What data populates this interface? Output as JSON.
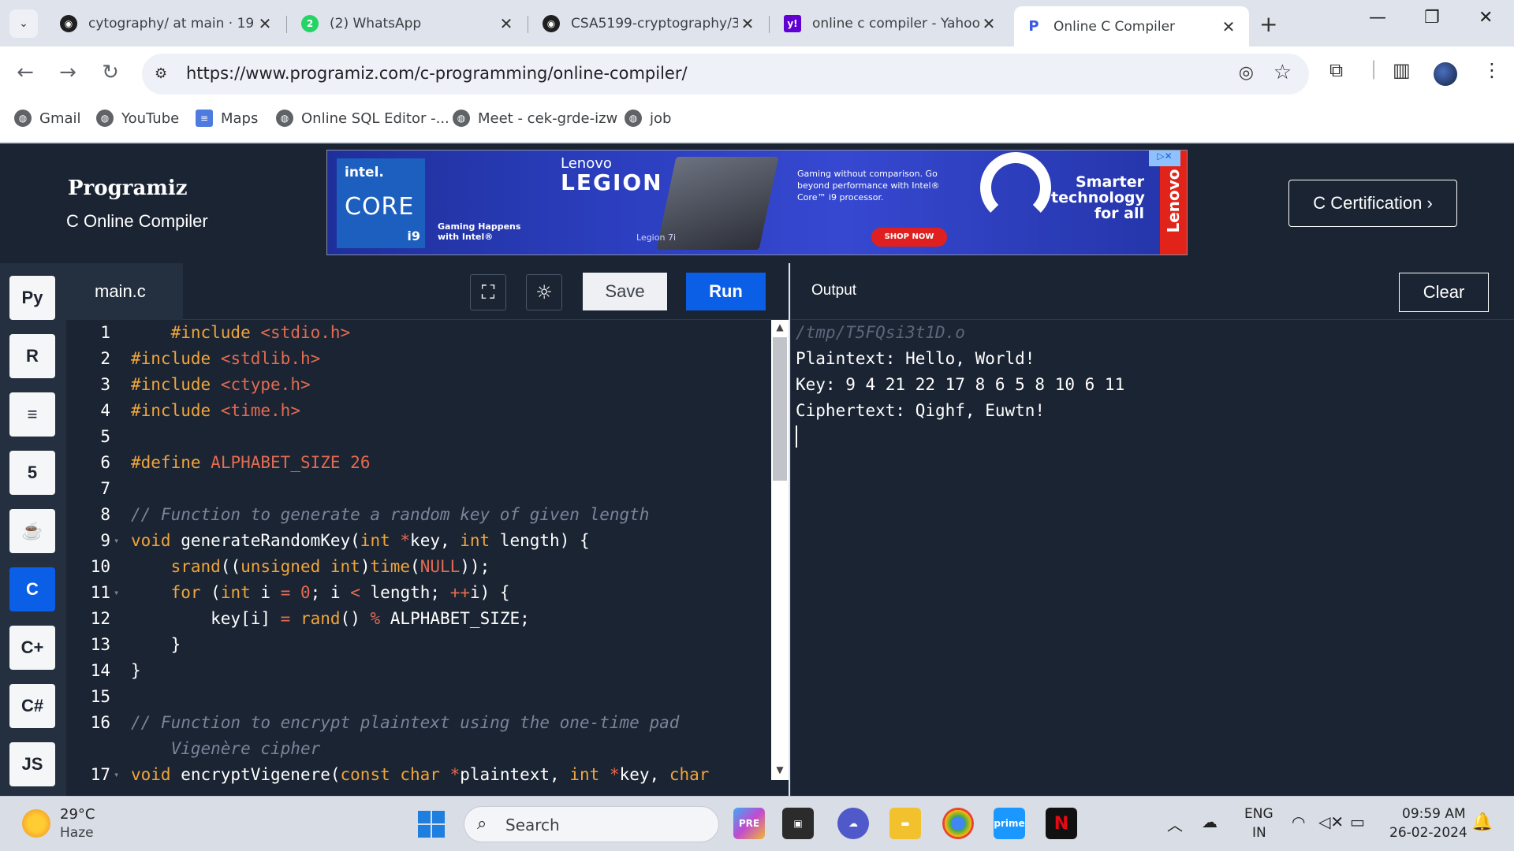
{
  "browser": {
    "tabs": [
      {
        "title": "cytography/ at main · 19",
        "icon": "github-icon"
      },
      {
        "title": "(2) WhatsApp",
        "icon": "whatsapp-icon",
        "badge": "2"
      },
      {
        "title": "CSA5199-cryptography/3",
        "icon": "github-icon"
      },
      {
        "title": "online c compiler - Yahoo",
        "icon": "yahoo-icon",
        "badge": "y!"
      },
      {
        "title": "Online C Compiler",
        "icon": "programiz-icon",
        "badge": "P"
      }
    ],
    "url": "https://www.programiz.com/c-programming/online-compiler/",
    "bookmarks": [
      {
        "label": "Gmail"
      },
      {
        "label": "YouTube"
      },
      {
        "label": "Maps"
      },
      {
        "label": "Online SQL Editor -..."
      },
      {
        "label": "Meet - cek-grde-izw"
      },
      {
        "label": "job"
      }
    ]
  },
  "site": {
    "logo": "Programiz",
    "subtitle": "C Online Compiler",
    "certification_label": "C Certification ›",
    "ad": {
      "intel_brand": "intel.",
      "intel_core": "CORE",
      "intel_tier": "i9",
      "lenovo_small": "Lenovo",
      "legion": "LEGION",
      "gaming": "Gaming Happens with Intel®",
      "model": "Legion 7i",
      "description": "Gaming without comparison. Go beyond performance with Intel® Core™ i9 processor.",
      "cta": "SHOP NOW",
      "tagline": "Smarter technology for all",
      "brand": "Lenovo"
    }
  },
  "sidebar": {
    "languages": [
      {
        "label": "Py",
        "icon": "python-icon"
      },
      {
        "label": "R",
        "icon": "r-icon"
      },
      {
        "label": "≡",
        "icon": "sql-icon"
      },
      {
        "label": "5",
        "icon": "html5-icon"
      },
      {
        "label": "☕",
        "icon": "java-icon"
      },
      {
        "label": "C",
        "icon": "c-icon",
        "active": true
      },
      {
        "label": "C+",
        "icon": "cpp-icon"
      },
      {
        "label": "C#",
        "icon": "csharp-icon"
      },
      {
        "label": "JS",
        "icon": "javascript-icon"
      }
    ]
  },
  "editor": {
    "filename": "main.c",
    "save_label": "Save",
    "run_label": "Run",
    "lines": [
      {
        "n": "1",
        "fold": "",
        "html": "    <span class='k-dir'>#include</span> <span class='k-str'>&lt;stdio.h&gt;</span>"
      },
      {
        "n": "2",
        "fold": "",
        "html": "<span class='k-dir'>#include</span> <span class='k-str'>&lt;stdlib.h&gt;</span>"
      },
      {
        "n": "3",
        "fold": "",
        "html": "<span class='k-dir'>#include</span> <span class='k-str'>&lt;ctype.h&gt;</span>"
      },
      {
        "n": "4",
        "fold": "",
        "html": "<span class='k-dir'>#include</span> <span class='k-str'>&lt;time.h&gt;</span>"
      },
      {
        "n": "5",
        "fold": "",
        "html": ""
      },
      {
        "n": "6",
        "fold": "",
        "html": "<span class='k-dir'>#define</span> <span class='k-str'>ALPHABET_SIZE 26</span>"
      },
      {
        "n": "7",
        "fold": "",
        "html": ""
      },
      {
        "n": "8",
        "fold": "",
        "html": "<span class='k-com'>// Function to generate a random key of given length</span>"
      },
      {
        "n": "9",
        "fold": "▾",
        "html": "<span class='k-kw'>void</span> generateRandomKey(<span class='k-kw'>int</span> <span class='k-op'>*</span>key, <span class='k-kw'>int</span> length) {"
      },
      {
        "n": "10",
        "fold": "",
        "html": "    <span class='k-kw'>srand</span>((<span class='k-kw'>unsigned int</span>)<span class='k-kw'>time</span>(<span class='k-num'>NULL</span>));"
      },
      {
        "n": "11",
        "fold": "▾",
        "html": "    <span class='k-kw'>for</span> (<span class='k-kw'>int</span> i <span class='k-op'>=</span> <span class='k-num'>0</span>; i <span class='k-op'>&lt;</span> length; <span class='k-op'>++</span>i) {"
      },
      {
        "n": "12",
        "fold": "",
        "html": "        key[i] <span class='k-op'>=</span> <span class='k-kw'>rand</span>() <span class='k-op'>%</span> ALPHABET_SIZE;"
      },
      {
        "n": "13",
        "fold": "",
        "html": "    }"
      },
      {
        "n": "14",
        "fold": "",
        "html": "}"
      },
      {
        "n": "15",
        "fold": "",
        "html": ""
      },
      {
        "n": "16",
        "fold": "",
        "html": "<span class='k-com'>// Function to encrypt plaintext using the one-time pad</span>"
      },
      {
        "n": "",
        "fold": "",
        "html": "    <span class='k-com'>Vigenère cipher</span>"
      },
      {
        "n": "17",
        "fold": "▾",
        "html": "<span class='k-kw'>void</span> encryptVigenere(<span class='k-kw'>const char</span> <span class='k-op'>*</span>plaintext, <span class='k-kw'>int</span> <span class='k-op'>*</span>key, <span class='k-kw'>char</span>"
      }
    ]
  },
  "output": {
    "title": "Output",
    "clear_label": "Clear",
    "path": "/tmp/T5FQsi3t1D.o",
    "lines": [
      "Plaintext: Hello, World!",
      "Key: 9 4 21 22 17 8 6 5 8 10 6 11",
      "Ciphertext: Qighf, Euwtn!"
    ]
  },
  "taskbar": {
    "temperature": "29°C",
    "weather": "Haze",
    "search_label": "Search",
    "lang_line1": "ENG",
    "lang_line2": "IN",
    "time": "09:59 AM",
    "date": "26-02-2024"
  }
}
